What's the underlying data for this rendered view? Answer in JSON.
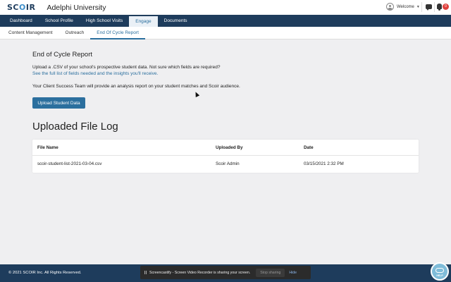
{
  "header": {
    "logo_prefix": "SC",
    "logo_o": "O",
    "logo_suffix": "IR",
    "university": "Adelphi University",
    "welcome": "Welcome",
    "notification_count": "0"
  },
  "nav": {
    "tabs": [
      "Dashboard",
      "School Profile",
      "High School Visits",
      "Engage",
      "Documents"
    ],
    "active": "Engage"
  },
  "subnav": {
    "tabs": [
      "Content Management",
      "Outreach",
      "End Of Cycle Report"
    ],
    "active": "End Of Cycle Report"
  },
  "main": {
    "title": "End of Cycle Report",
    "intro": "Upload a .CSV of your school's prospective student data. Not sure which fields are required?",
    "fields_link": "See the full list of fields needed and the insights you'll receive.",
    "team_note": "Your Client Success Team will provide an analysis report on your student matches and Scoir audience.",
    "upload_button": "Upload Student Data"
  },
  "file_log": {
    "title": "Uploaded File Log",
    "columns": [
      "File Name",
      "Uploaded By",
      "Date"
    ],
    "rows": [
      [
        "scoir-student-list-2021-03-04.csv",
        "Scoir Admin",
        "03/15/2021 2:32 PM"
      ]
    ]
  },
  "footer": {
    "copyright": "© 2021 SCOIR Inc. All Rights Reserved."
  },
  "screencast": {
    "message": "Screencastify - Screen Video Recorder is sharing your screen.",
    "stop_label": "Stop sharing",
    "hide_label": "Hide"
  },
  "help": {
    "label": "HELP"
  },
  "colors": {
    "brand_navy": "#1e3c5c",
    "accent_blue": "#2b6f9e",
    "notification_red": "#e0403c"
  }
}
